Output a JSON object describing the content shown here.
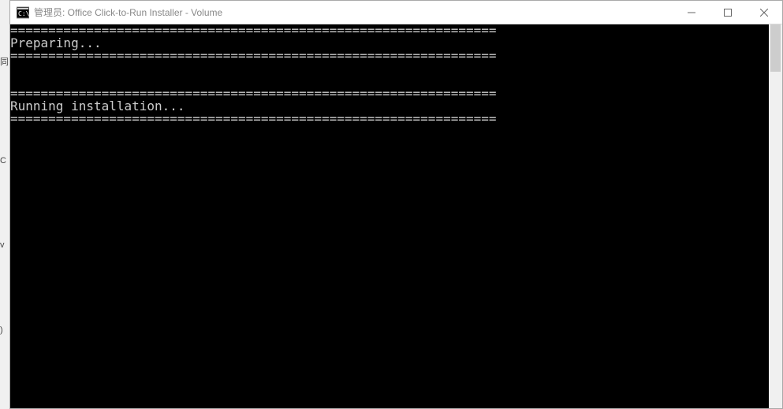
{
  "left_fragments": {
    "a": "同",
    "b": "C",
    "c": "v",
    "d": ")"
  },
  "window": {
    "title": "管理员:  Office Click-to-Run Installer - Volume",
    "icon_name": "cmd-icon"
  },
  "console": {
    "lines": [
      "================================================================",
      "Preparing...",
      "================================================================",
      "",
      "",
      "================================================================",
      "Running installation...",
      "================================================================"
    ]
  }
}
